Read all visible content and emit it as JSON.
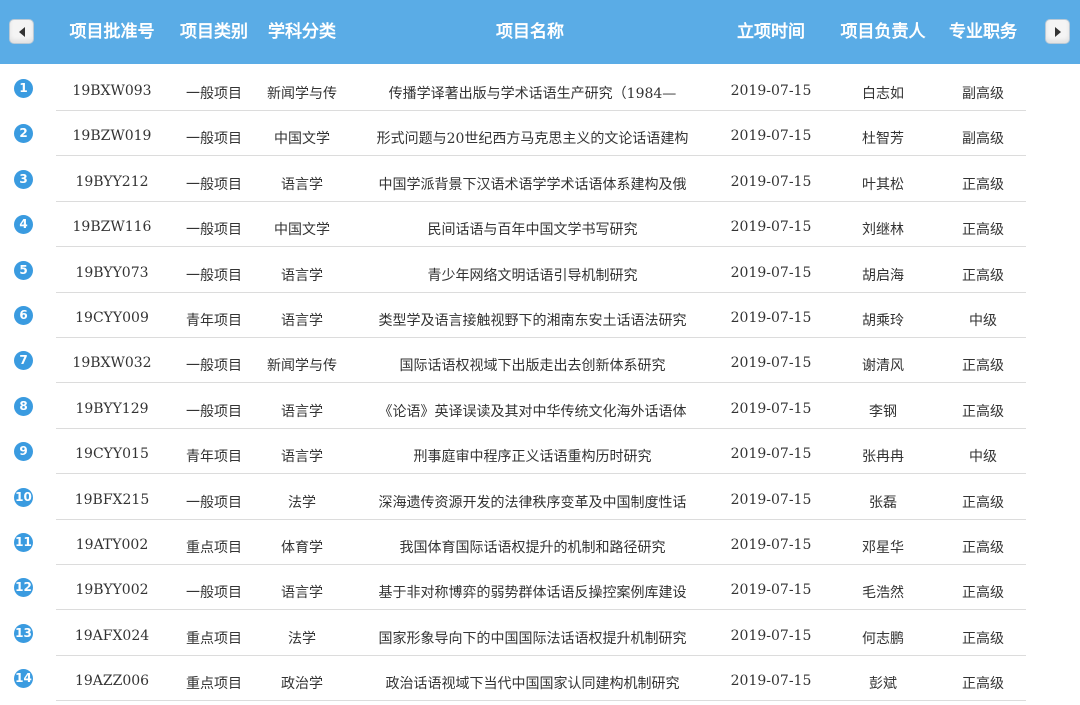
{
  "header": {
    "columns": [
      "项目批准号",
      "项目类别",
      "学科分类",
      "项目名称",
      "立项时间",
      "项目负责人",
      "专业职务"
    ]
  },
  "rows": [
    {
      "index": "1",
      "code": "19BXW093",
      "category": "一般项目",
      "discipline": "新闻学与传",
      "name": "传播学译著出版与学术话语生产研究（1984—",
      "date": "2019-07-15",
      "leader": "白志如",
      "title": "副高级"
    },
    {
      "index": "2",
      "code": "19BZW019",
      "category": "一般项目",
      "discipline": "中国文学",
      "name": "形式问题与20世纪西方马克思主义的文论话语建构",
      "date": "2019-07-15",
      "leader": "杜智芳",
      "title": "副高级"
    },
    {
      "index": "3",
      "code": "19BYY212",
      "category": "一般项目",
      "discipline": "语言学",
      "name": "中国学派背景下汉语术语学学术话语体系建构及俄",
      "date": "2019-07-15",
      "leader": "叶其松",
      "title": "正高级"
    },
    {
      "index": "4",
      "code": "19BZW116",
      "category": "一般项目",
      "discipline": "中国文学",
      "name": "民间话语与百年中国文学书写研究",
      "date": "2019-07-15",
      "leader": "刘继林",
      "title": "正高级"
    },
    {
      "index": "5",
      "code": "19BYY073",
      "category": "一般项目",
      "discipline": "语言学",
      "name": "青少年网络文明话语引导机制研究",
      "date": "2019-07-15",
      "leader": "胡启海",
      "title": "正高级"
    },
    {
      "index": "6",
      "code": "19CYY009",
      "category": "青年项目",
      "discipline": "语言学",
      "name": "类型学及语言接触视野下的湘南东安土话语法研究",
      "date": "2019-07-15",
      "leader": "胡乘玲",
      "title": "中级"
    },
    {
      "index": "7",
      "code": "19BXW032",
      "category": "一般项目",
      "discipline": "新闻学与传",
      "name": "国际话语权视域下出版走出去创新体系研究",
      "date": "2019-07-15",
      "leader": "谢清风",
      "title": "正高级"
    },
    {
      "index": "8",
      "code": "19BYY129",
      "category": "一般项目",
      "discipline": "语言学",
      "name": "《论语》英译误读及其对中华传统文化海外话语体",
      "date": "2019-07-15",
      "leader": "李钢",
      "title": "正高级"
    },
    {
      "index": "9",
      "code": "19CYY015",
      "category": "青年项目",
      "discipline": "语言学",
      "name": "刑事庭审中程序正义话语重构历时研究",
      "date": "2019-07-15",
      "leader": "张冉冉",
      "title": "中级"
    },
    {
      "index": "10",
      "code": "19BFX215",
      "category": "一般项目",
      "discipline": "法学",
      "name": "深海遗传资源开发的法律秩序变革及中国制度性话",
      "date": "2019-07-15",
      "leader": "张磊",
      "title": "正高级"
    },
    {
      "index": "11",
      "code": "19ATY002",
      "category": "重点项目",
      "discipline": "体育学",
      "name": "我国体育国际话语权提升的机制和路径研究",
      "date": "2019-07-15",
      "leader": "邓星华",
      "title": "正高级"
    },
    {
      "index": "12",
      "code": "19BYY002",
      "category": "一般项目",
      "discipline": "语言学",
      "name": "基于非对称博弈的弱势群体话语反操控案例库建设",
      "date": "2019-07-15",
      "leader": "毛浩然",
      "title": "正高级"
    },
    {
      "index": "13",
      "code": "19AFX024",
      "category": "重点项目",
      "discipline": "法学",
      "name": "国家形象导向下的中国国际法话语权提升机制研究",
      "date": "2019-07-15",
      "leader": "何志鹏",
      "title": "正高级"
    },
    {
      "index": "14",
      "code": "19AZZ006",
      "category": "重点项目",
      "discipline": "政治学",
      "name": "政治话语视域下当代中国国家认同建构机制研究",
      "date": "2019-07-15",
      "leader": "彭斌",
      "title": "正高级"
    }
  ]
}
